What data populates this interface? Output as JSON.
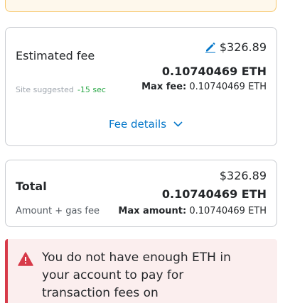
{
  "fee": {
    "label": "Estimated fee",
    "fiat": "$326.89",
    "eth": "0.10740469 ETH",
    "suggested_label": "Site suggested",
    "time": "-15 sec",
    "max_label": "Max fee:",
    "max_value": "0.10740469 ETH",
    "details_link": "Fee details"
  },
  "total": {
    "label": "Total",
    "fiat": "$326.89",
    "eth": "0.10740469 ETH",
    "sub_label": "Amount + gas fee",
    "max_label": "Max amount:",
    "max_value": "0.10740469 ETH"
  },
  "error": {
    "message": "You do not have enough ETH in your account to pay for transaction fees on"
  },
  "colors": {
    "link": "#0376c9",
    "success": "#28a745",
    "error": "#d73a49",
    "warning_border": "#f7c76a"
  },
  "icons": {
    "edit": "pencil-icon",
    "error": "warning-triangle-icon",
    "chevron": "chevron-down-icon"
  }
}
